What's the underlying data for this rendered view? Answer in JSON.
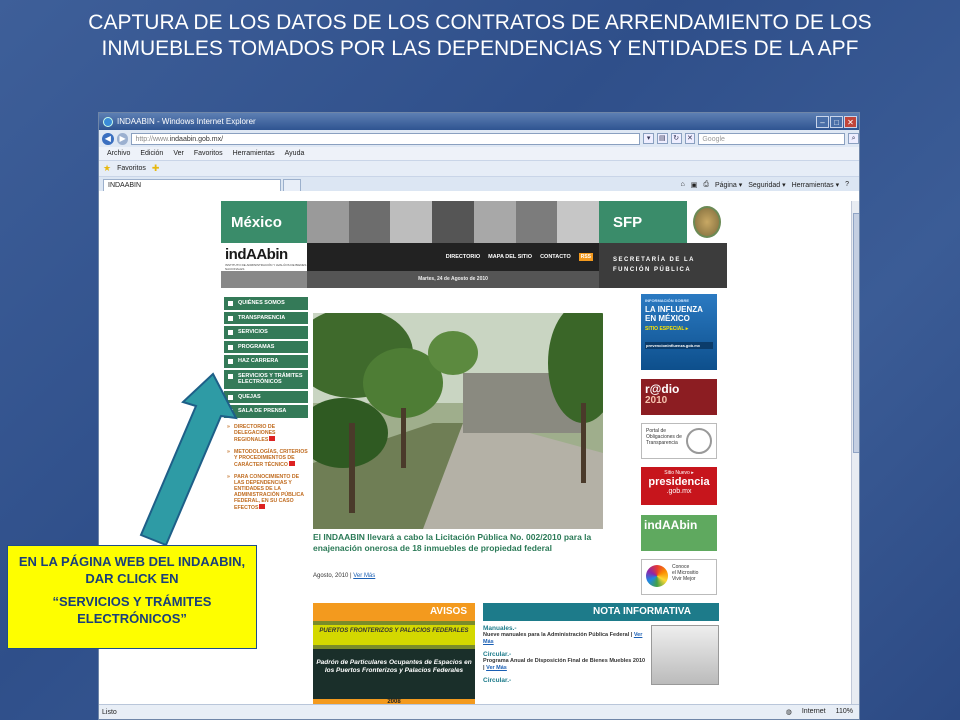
{
  "slide": {
    "title": "CAPTURA DE LOS DATOS DE LOS CONTRATOS DE ARRENDAMIENTO DE LOS INMUEBLES TOMADOS POR LAS DEPENDENCIAS Y ENTIDADES DE LA APF",
    "callout_line1": "EN LA PÁGINA WEB DEL INDAABIN, DAR CLICK EN",
    "callout_line2": "“SERVICIOS Y TRÁMITES ELECTRÓNICOS”"
  },
  "browser": {
    "window_title": "INDAABIN - Windows Internet Explorer",
    "address_prefix": "http://www.",
    "address": "indaabin.gob.mx/",
    "search_placeholder": "Google",
    "menu": [
      "Archivo",
      "Edición",
      "Ver",
      "Favoritos",
      "Herramientas",
      "Ayuda"
    ],
    "favorites_label": "Favoritos",
    "tab_label": "INDAABIN",
    "cmd": [
      "Página ▾",
      "Seguridad ▾",
      "Herramientas ▾"
    ],
    "status_left": "Listo",
    "status_zone": "Internet",
    "zoom": "110%"
  },
  "site": {
    "mexico": "México",
    "sfp": "SFP",
    "logo": "indAAbin",
    "logo_sub": "INSTITUTO DE ADMINISTRACIÓN Y AVALÚOS DE BIENES NACIONALES",
    "nav": [
      "DIRECTORIO",
      "MAPA DEL SITIO",
      "CONTACTO"
    ],
    "rss": "RSS",
    "date": "Martes, 24 de Agosto de 2010",
    "sfp_sub_line1": "SECRETARÍA DE LA",
    "sfp_sub_line2": "FUNCIÓN PÚBLICA",
    "left_nav": [
      "QUIÉNES SOMOS",
      "TRANSPARENCIA",
      "SERVICIOS",
      "PROGRAMAS",
      "HAZ CARRERA",
      "SERVICIOS Y TRÁMITES ELECTRÓNICOS",
      "QUEJAS",
      "SALA DE PRENSA"
    ],
    "sub_links": [
      "DIRECTORIO DE DELEGACIONES REGIONALES",
      "METODOLOGÍAS, CRITERIOS Y PROCEDIMIENTOS DE CARÁCTER TÉCNICO",
      "PARA CONOCIMIENTO DE LAS DEPENDENCIAS Y ENTIDADES DE LA ADMINISTRACIÓN PÚBLICA FEDERAL, EN SU CASO EFECTOS"
    ],
    "news_title": "El INDAABIN llevará a cabo la Licitación Pública No. 002/2010 para la enajenación onerosa de 18 inmuebles de propiedad federal",
    "news_date": "Agosto, 2010 |",
    "news_more": "Ver Más",
    "banners": {
      "influenza_s1": "INFORMACIÓN SOBRE",
      "influenza_s2": "LA INFLUENZA EN MÉXICO",
      "influenza_s3": "SITIO ESPECIAL ▸",
      "influenza_s4": "prevencioninfluenza.gob.mx",
      "radio": "r@dio",
      "radio_year": "2010",
      "pot_l1": "Portal de",
      "pot_l2": "Obligaciones de",
      "pot_l3": "Transparencia",
      "pres_a": "Sitio Nuevo ▸",
      "pres_b": "presidencia",
      "pres_c": ".gob.mx",
      "indaabin": "indAAbin",
      "vivir_l1": "Conoce",
      "vivir_l2": "el Micrositio",
      "vivir_l3": "Vivir Mejor"
    },
    "avisos": {
      "header": "AVISOS",
      "band": "PUERTOS FRONTERIZOS Y PALACIOS FEDERALES",
      "dark": "Padrón de Particulares Ocupantes de Espacios en los Puertos Fronterizos y Palacios Federales",
      "year": "2008"
    },
    "nota": {
      "header": "NOTA INFORMATIVA",
      "items": [
        {
          "h": "Manuales.-",
          "t": "Nueve manuales para la Administración Pública Federal |",
          "more": "Ver Más"
        },
        {
          "h": "Circular.-",
          "t": "Programa Anual de Disposición Final de Bienes Muebles 2010 |",
          "more": "Ver Más"
        },
        {
          "h": "Circular.-",
          "t": "",
          "more": ""
        }
      ]
    }
  }
}
